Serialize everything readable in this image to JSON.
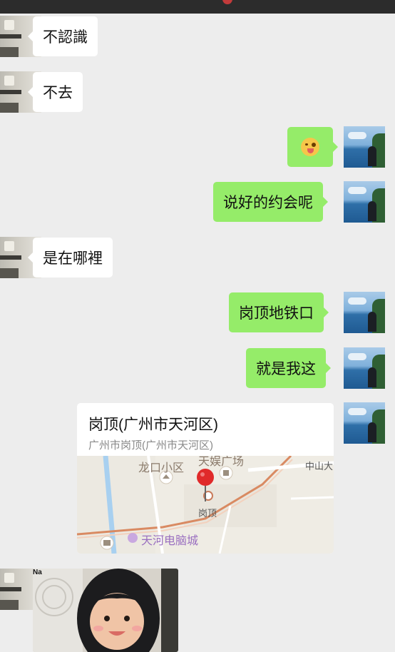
{
  "messages": {
    "m1": "不認識",
    "m2": "不去",
    "m4": "说好的约会呢",
    "m5": "是在哪裡",
    "m6": "岗顶地铁口",
    "m7": "就是我这"
  },
  "emoji_message": {
    "icon": "tongue-out-emoji"
  },
  "location": {
    "title": "岗顶(广州市天河区)",
    "subtitle": "广州市岗顶(广州市天河区)",
    "map_labels": {
      "longkou": "龙口小区",
      "tianyu": "天娱广场",
      "zhongshan": "中山大",
      "gangding": "岗顶",
      "tianhe_mall": "天河电脑城"
    },
    "pin_color": "#e02a2a"
  },
  "photo_message": {
    "caption": "Na"
  },
  "colors": {
    "background": "#ededed",
    "sent_bubble": "#95ec69",
    "received_bubble": "#ffffff"
  }
}
